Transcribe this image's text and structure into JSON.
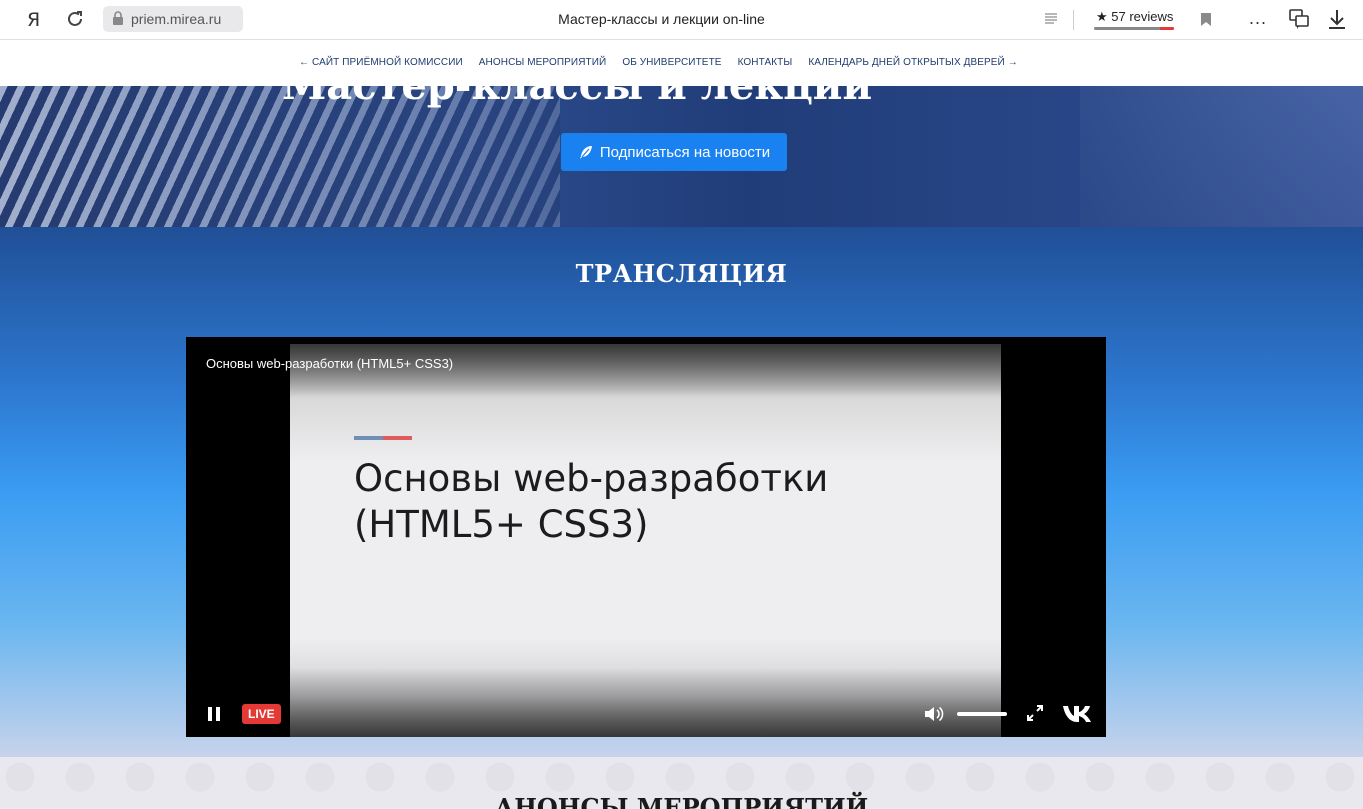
{
  "browser": {
    "logo": "Я",
    "domain": "priem.mirea.ru",
    "tab_title": "Мастер-классы и лекции on-line",
    "reviews": "★ 57 reviews",
    "more": "..."
  },
  "nav": {
    "items": [
      "← САЙТ ПРИЁМНОЙ КОМИССИИ",
      "АНОНСЫ МЕРОПРИЯТИЙ",
      "ОБ УНИВЕРСИТЕТЕ",
      "КОНТАКТЫ",
      "КАЛЕНДАРЬ ДНЕЙ ОТКРЫТЫХ ДВЕРЕЙ →"
    ]
  },
  "hero": {
    "title": "Мастер-классы и лекции",
    "subscribe_label": "Подписаться на новости"
  },
  "stream": {
    "title": "ТРАНСЛЯЦИЯ",
    "video_title": "Основы web-разработки (HTML5+ CSS3)",
    "slide_title": "Основы web-разработки (HTML5+ CSS3)",
    "live_label": "LIVE",
    "volume_level": 1.0
  },
  "announce": {
    "title": "АНОНСЫ МЕРОПРИЯТИЙ"
  },
  "colors": {
    "accent": "#1a82f0",
    "live": "#e53935",
    "nav_text": "#1f3d6f"
  },
  "icons": [
    "reload-icon",
    "lock-icon",
    "reader-icon",
    "bookmark-icon",
    "promo-icon",
    "download-icon",
    "feather-icon",
    "pause-icon",
    "volume-icon",
    "fullscreen-icon",
    "vk-icon"
  ]
}
